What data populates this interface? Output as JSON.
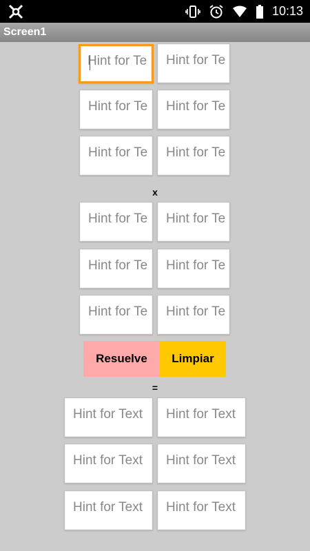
{
  "status": {
    "time": "10:13"
  },
  "screen": {
    "title": "Screen1"
  },
  "matrix_a": {
    "placeholders": [
      "Hint for Te",
      "Hint for Te",
      "Hint for Te",
      "Hint for Te",
      "Hint for Te",
      "Hint for Te"
    ]
  },
  "operator_label": "x",
  "matrix_b": {
    "placeholders": [
      "Hint for Te",
      "Hint for Te",
      "Hint for Te",
      "Hint for Te",
      "Hint for Te",
      "Hint for Te"
    ]
  },
  "buttons": {
    "solve": "Resuelve",
    "clear": "Limpiar"
  },
  "equals_label": "=",
  "result": {
    "placeholders": [
      "Hint for Text",
      "Hint for Text",
      "Hint for Text",
      "Hint for Text",
      "Hint for Text",
      "Hint for Text"
    ]
  },
  "colors": {
    "solve_bg": "#ffaaaa",
    "clear_bg": "#ffc800",
    "focus_border": "#f59b1e"
  },
  "icons": [
    "app-notification-icon",
    "vibrate-icon",
    "alarm-icon",
    "wifi-icon",
    "battery-icon"
  ]
}
